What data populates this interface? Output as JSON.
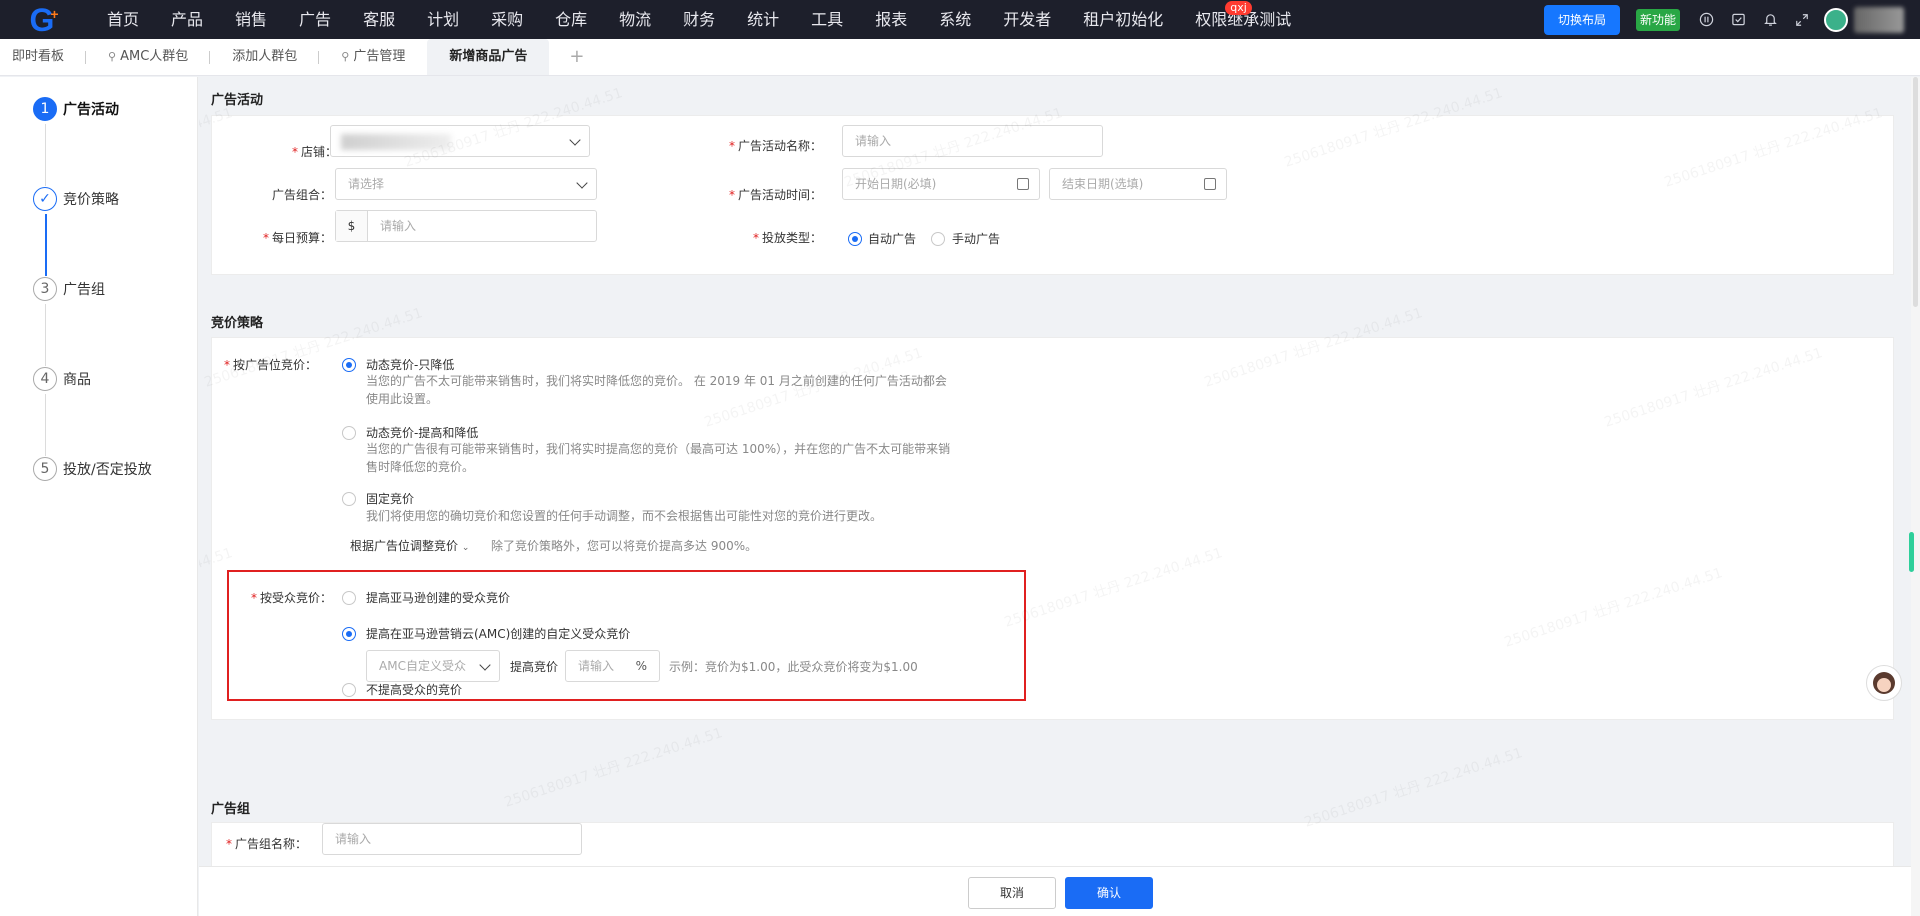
{
  "nav": {
    "logo_letter": "G",
    "items": [
      "首页",
      "产品",
      "销售",
      "广告",
      "客服",
      "计划",
      "采购",
      "仓库",
      "物流",
      "财务",
      "统计",
      "工具",
      "报表",
      "系统",
      "开发者",
      "租户初始化",
      "权限继承测试"
    ],
    "badge": "qxj",
    "switch_layout": "切换布局",
    "new_feature": "新功能"
  },
  "tabs": [
    {
      "label": "即时看板",
      "pinned": false
    },
    {
      "label": "AMC人群包",
      "pinned": true
    },
    {
      "label": "添加人群包",
      "pinned": false
    },
    {
      "label": "广告管理",
      "pinned": true
    },
    {
      "label": "新增商品广告",
      "pinned": false,
      "active": true
    }
  ],
  "tab_add": "+",
  "steps": [
    {
      "num": "1",
      "label": "广告活动",
      "state": "active"
    },
    {
      "num": "✓",
      "label": "竞价策略",
      "state": "done"
    },
    {
      "num": "3",
      "label": "广告组",
      "state": "todo"
    },
    {
      "num": "4",
      "label": "商品",
      "state": "todo"
    },
    {
      "num": "5",
      "label": "投放/否定投放",
      "state": "todo"
    }
  ],
  "campaign": {
    "section_title": "广告活动",
    "store_label": "店铺：",
    "name_label": "广告活动名称：",
    "name_placeholder": "请输入",
    "portfolio_label": "广告组合：",
    "portfolio_placeholder": "请选择",
    "time_label": "广告活动时间：",
    "start_placeholder": "开始日期(必填)",
    "end_placeholder": "结束日期(选填)",
    "budget_label": "每日预算：",
    "currency": "$",
    "budget_placeholder": "请输入",
    "type_label": "投放类型：",
    "type_auto": "自动广告",
    "type_manual": "手动广告"
  },
  "bidding": {
    "section_title": "竞价策略",
    "placement_label": "按广告位竞价：",
    "opt1_title": "动态竞价-只降低",
    "opt1_desc": "当您的广告不太可能带来销售时，我们将实时降低您的竞价。 在 2019 年 01 月之前创建的任何广告活动都会使用此设置。",
    "opt2_title": "动态竞价-提高和降低",
    "opt2_desc": "当您的广告很有可能带来销售时，我们将实时提高您的竞价（最高可达 100%），并在您的广告不太可能带来销售时降低您的竞价。",
    "opt3_title": "固定竞价",
    "opt3_desc": "我们将使用您的确切竞价和您设置的任何手动调整，而不会根据售出可能性对您的竞价进行更改。",
    "adjust_link": "根据广告位调整竞价",
    "adjust_note": "除了竞价策略外，您可以将竞价提高多达 900%。",
    "audience_label": "按受众竞价：",
    "aud_opt1": "提高亚马逊创建的受众竞价",
    "aud_opt2": "提高在亚马逊营销云(AMC)创建的自定义受众竞价",
    "aud_select": "AMC自定义受众",
    "raise_label": "提高竞价",
    "raise_placeholder": "请输入",
    "percent": "%",
    "example": "示例：竞价为$1.00，此受众竞价将变为$1.00",
    "aud_opt3": "不提高受众的竞价"
  },
  "adgroup": {
    "section_title": "广告组",
    "name_label": "广告组名称：",
    "name_placeholder": "请输入"
  },
  "footer": {
    "cancel": "取消",
    "confirm": "确认"
  },
  "watermark": "2506180917 壮丹 222.240.44.51",
  "colors": {
    "primary": "#1a6cf5",
    "nav_bg": "#1d1f2b",
    "danger": "#e02020",
    "success": "#29a745"
  }
}
